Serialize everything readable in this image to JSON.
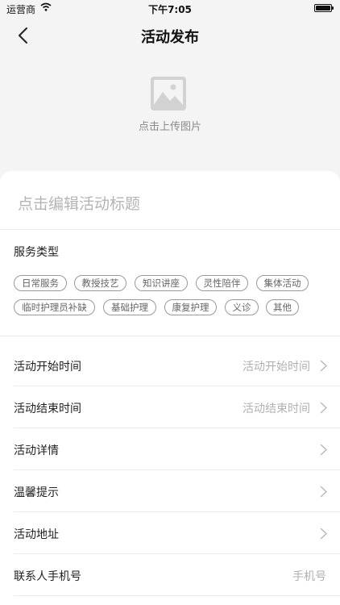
{
  "status_bar": {
    "carrier": "运营商",
    "time": "下午7:05"
  },
  "nav": {
    "title": "活动发布",
    "back_icon": "chevron-left-icon"
  },
  "upload": {
    "label": "点击上传图片",
    "icon": "image-placeholder-icon"
  },
  "form": {
    "title_placeholder": "点击编辑活动标题",
    "service_type_label": "服务类型",
    "service_tags": [
      "日常服务",
      "教授技艺",
      "知识讲座",
      "灵性陪伴",
      "集体活动",
      "临时护理员补缺",
      "基础护理",
      "康复护理",
      "义诊",
      "其他"
    ],
    "rows": [
      {
        "label": "活动开始时间",
        "value": "活动开始时间"
      },
      {
        "label": "活动结束时间",
        "value": "活动结束时间"
      },
      {
        "label": "活动详情",
        "value": ""
      },
      {
        "label": "温馨提示",
        "value": ""
      },
      {
        "label": "活动地址",
        "value": ""
      },
      {
        "label": "联系人手机号",
        "value": "手机号"
      }
    ]
  },
  "colors": {
    "background": "#f4f4f4",
    "card": "#ffffff",
    "placeholder": "#b4b4b4",
    "tag_border": "#9a9a9a"
  }
}
